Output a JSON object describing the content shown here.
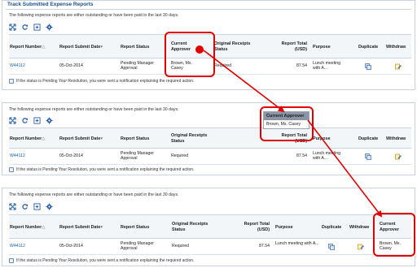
{
  "panel1": {
    "title": "Track Submitted Expense Reports",
    "intro": "The following expense reports are either outstanding or have been paid in the last 30 days."
  },
  "intro_text": "The following expense reports are either outstanding or have been paid in the last 30 days.",
  "columns": {
    "report_number": "Report Number",
    "submit_date": "Report Submit Date",
    "status": "Report Status",
    "current_approver": "Current Approver",
    "current_approver_l1": "Current",
    "current_approver_l2": "Approver",
    "original_receipts": "Original Receipts Status",
    "original_receipts_l1": "Original Receipts",
    "original_receipts_l2": "Status",
    "report_total_l1": "Report Total",
    "report_total_l2": "(USD)",
    "purpose": "Purpose",
    "duplicate": "Duplicate",
    "withdraw": "Withdraw",
    "sort_asc": "△",
    "sort_desc": "▾"
  },
  "row": {
    "report_number": "W44112",
    "submit_date": "05-Oct-2014",
    "status_l1": "Pending Manager",
    "status_l2": "Approval",
    "approver_l1": "Brown, Ms.",
    "approver_l2": "Casey",
    "receipts": "Required",
    "total": "87.54",
    "purpose_l1": "Lunch meeting",
    "purpose_l2": "with A...",
    "purpose_long": "Lunch meeting with A..."
  },
  "popup": {
    "header": "Current Approver",
    "value": "Brown, Ms. Casey"
  },
  "note": "If the status is Pending Your Resolution, you were sent a notification explaining the required action.",
  "colors": {
    "annotation": "#e00000",
    "link": "#1660b3",
    "title": "#1a4f8a"
  }
}
